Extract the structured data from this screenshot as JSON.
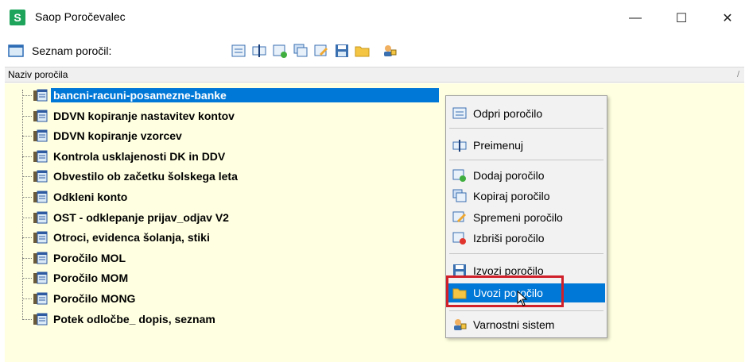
{
  "window": {
    "title": "Saop Poročevalec",
    "app_icon_letter": "S",
    "minimize_glyph": "—",
    "maximize_glyph": "☐",
    "close_glyph": "✕"
  },
  "toolbar": {
    "label": "Seznam poročil:",
    "icons": [
      "open-report-icon",
      "rename-icon",
      "add-report-icon",
      "copy-report-icon",
      "edit-report-icon",
      "save-report-icon",
      "folder-icon",
      "security-icon"
    ]
  },
  "list_header": {
    "column": "Naziv poročila",
    "sort_mark": "/"
  },
  "reports": [
    "bancni-racuni-posamezne-banke",
    "DDVN kopiranje nastavitev kontov",
    "DDVN kopiranje vzorcev",
    "Kontrola usklajenosti DK in DDV",
    "Obvestilo ob začetku šolskega leta",
    "Odkleni konto",
    "OST - odklepanje prijav_odjav V2",
    "Otroci, evidenca šolanja, stiki",
    "Poročilo MOL",
    "Poročilo MOM",
    "Poročilo MONG",
    "Potek odločbe_ dopis, seznam"
  ],
  "selected_report_index": 0,
  "context_menu": {
    "open": "Odpri poročilo",
    "rename": "Preimenuj",
    "add": "Dodaj poročilo",
    "copy": "Kopiraj poročilo",
    "edit": "Spremeni poročilo",
    "delete": "Izbriši poročilo",
    "export": "Izvozi poročilo",
    "import": "Uvozi poročilo",
    "security": "Varnostni sistem"
  },
  "colors": {
    "accent": "#0078d7",
    "tree_bg": "#ffffe1",
    "highlight_box": "#d0202a",
    "app_icon": "#1fa45c"
  }
}
